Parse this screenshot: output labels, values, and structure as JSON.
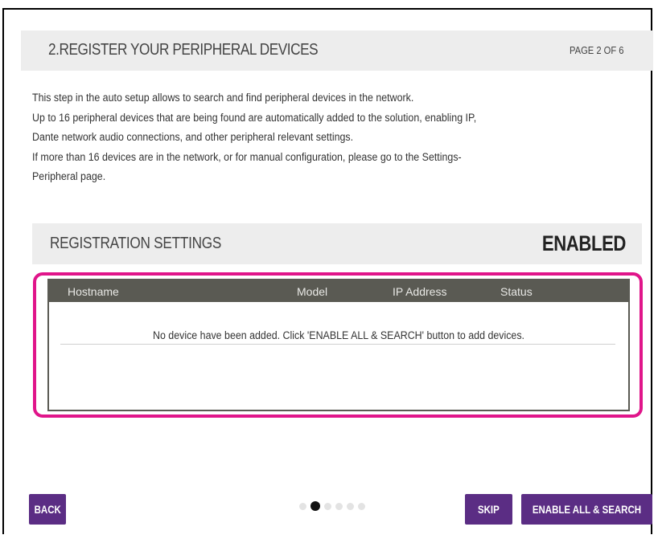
{
  "header": {
    "title": "2.REGISTER YOUR PERIPHERAL DEVICES",
    "page_indicator": "PAGE 2 OF 6"
  },
  "description": [
    "This step in the auto setup allows to search and find peripheral devices in the network.",
    "Up to 16 peripheral devices that are being found are automatically added to the solution, enabling IP,",
    "Dante network audio connections, and other peripheral relevant settings.",
    "If more than 16 devices are in the network, or for manual configuration, please go to the Settings-",
    "Peripheral page."
  ],
  "registration": {
    "title": "REGISTRATION SETTINGS",
    "status": "ENABLED"
  },
  "table": {
    "columns": [
      "Hostname",
      "Model",
      "IP Address",
      "Status"
    ],
    "rows": [],
    "empty_message": "No device have been added. Click 'ENABLE ALL & SEARCH' button to add devices."
  },
  "buttons": {
    "back": "BACK",
    "skip": "SKIP",
    "enable_all_search": "ENABLE ALL & SEARCH"
  },
  "pager": {
    "total": 6,
    "current": 2
  },
  "colors": {
    "button_bg": "#5b2d84",
    "highlight_border": "#e0158a",
    "table_header_bg": "#5a5a53",
    "section_bg": "#ededed"
  }
}
